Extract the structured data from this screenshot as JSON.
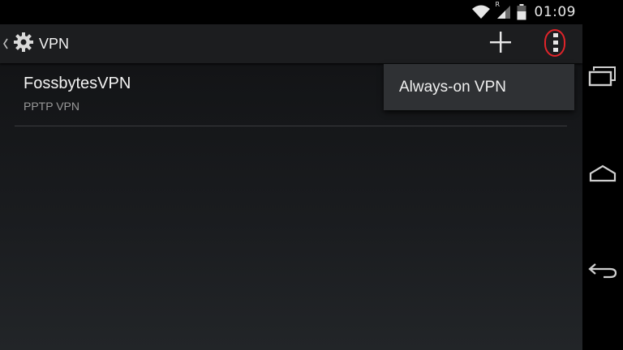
{
  "status_bar": {
    "time": "01:09",
    "roaming_indicator": "R",
    "icons": [
      "wifi-icon",
      "cell-signal-icon",
      "battery-icon"
    ]
  },
  "action_bar": {
    "title": "VPN",
    "icons": [
      "back-caret-icon",
      "settings-gear-icon",
      "add-icon",
      "overflow-menu-icon"
    ]
  },
  "vpn_list": [
    {
      "name": "FossbytesVPN",
      "type": "PPTP VPN"
    }
  ],
  "overflow_menu": {
    "items": [
      {
        "label": "Always-on VPN"
      }
    ]
  },
  "nav_bar": {
    "buttons": [
      "recent-apps-icon",
      "home-icon",
      "back-icon"
    ]
  },
  "colors": {
    "highlight": "#e0242a",
    "action_bar_bg": "#1c1d1f",
    "menu_bg": "#2f3134",
    "divider": "#3b3d40"
  }
}
